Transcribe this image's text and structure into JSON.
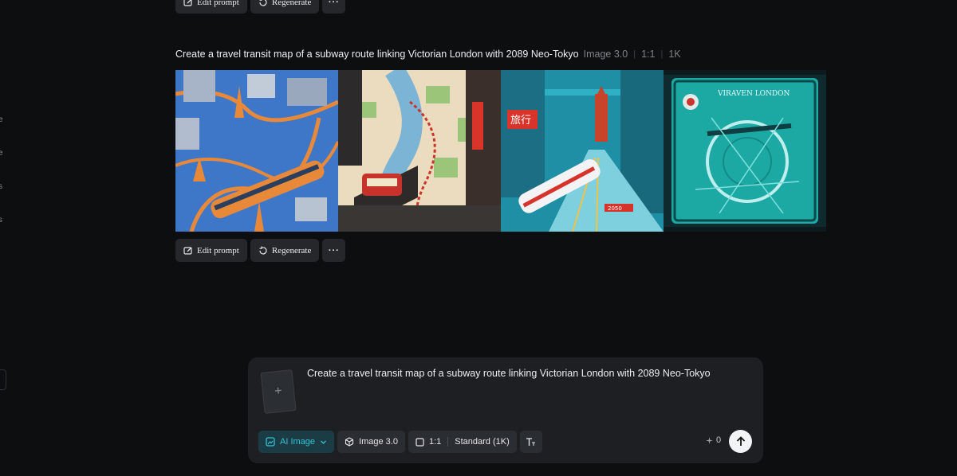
{
  "sidebar_fragments": [
    "e",
    "e",
    "s",
    "s"
  ],
  "top_actions": {
    "edit_label": "Edit prompt",
    "regenerate_label": "Regenerate",
    "more_label": "···"
  },
  "generation": {
    "prompt": "Create a travel transit map of a subway route linking Victorian London with 2089 Neo-Tokyo",
    "model": "Image 3.0",
    "ratio": "1:1",
    "resolution": "1K",
    "images": [
      {
        "name": "isometric-orange-train-map"
      },
      {
        "name": "illustrated-river-map-red-train"
      },
      {
        "name": "neo-tokyo-street-train",
        "sign_text": "旅行",
        "year_text": "2050"
      },
      {
        "name": "teal-circular-transit-map",
        "title_text": "VIRAVEN LONDON"
      }
    ],
    "actions": {
      "edit_label": "Edit prompt",
      "regenerate_label": "Regenerate",
      "more_label": "···"
    }
  },
  "composer": {
    "text": "Create a travel transit map of a subway route linking Victorian London with 2089 Neo-Tokyo",
    "upload_icon": "plus-icon",
    "mode_label": "AI Image",
    "model_label": "Image 3.0",
    "ratio_label": "1:1",
    "quality_label": "Standard (1K)",
    "credits_value": "0",
    "accent_color": "#35c2d6"
  }
}
